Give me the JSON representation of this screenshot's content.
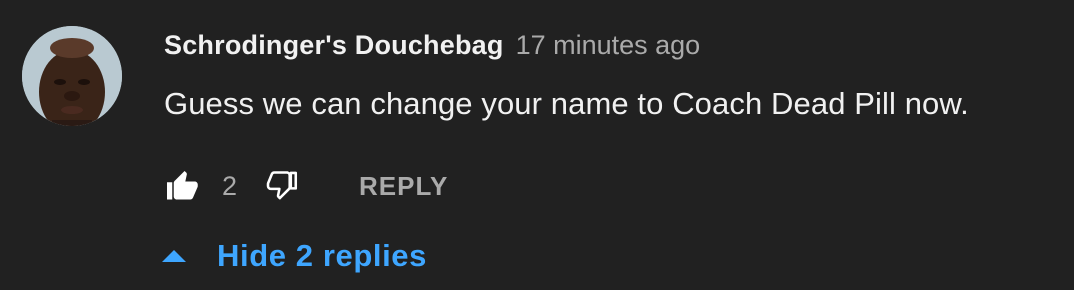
{
  "comment": {
    "author": "Schrodinger's Douchebag",
    "timestamp": "17 minutes ago",
    "text": "Guess we can change your name to Coach Dead Pill now.",
    "avatar": "author-avatar-photo"
  },
  "actions": {
    "like_icon": "thumbs-up-filled-icon",
    "like_count": "2",
    "dislike_icon": "thumbs-down-outline-icon",
    "reply_label": "REPLY"
  },
  "replies": {
    "toggle_icon": "caret-up-icon",
    "toggle_label": "Hide 2 replies"
  },
  "colors": {
    "background": "#212121",
    "primary_text": "#f1f1f1",
    "secondary_text": "#aaaaaa",
    "link": "#3ea6ff"
  }
}
